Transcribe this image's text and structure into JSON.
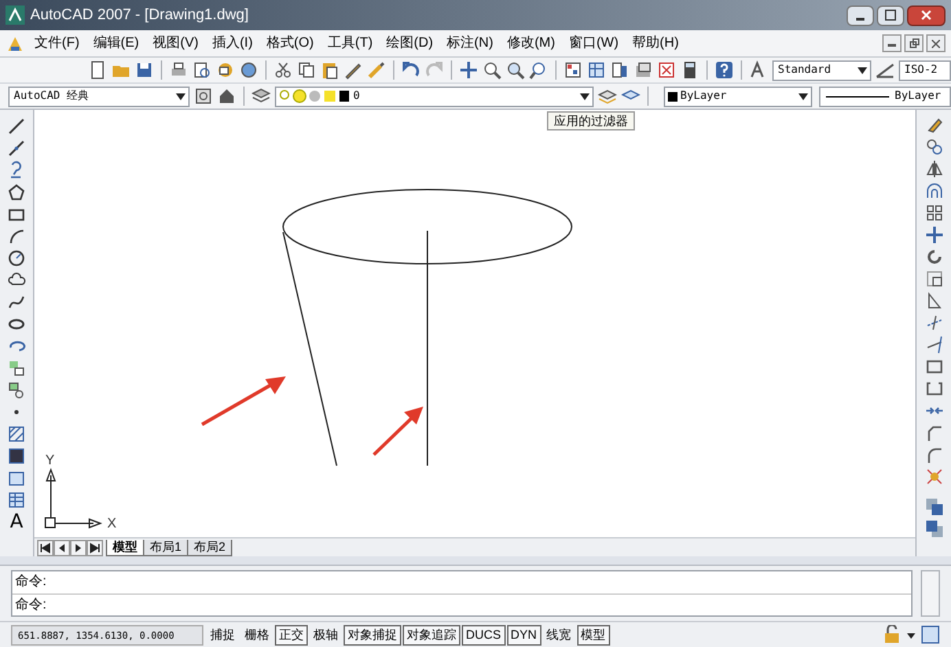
{
  "window": {
    "title": "AutoCAD 2007 - [Drawing1.dwg]"
  },
  "menu": [
    "文件(F)",
    "编辑(E)",
    "视图(V)",
    "插入(I)",
    "格式(O)",
    "工具(T)",
    "绘图(D)",
    "标注(N)",
    "修改(M)",
    "窗口(W)",
    "帮助(H)"
  ],
  "styles_toolbar": {
    "text_style": "Standard",
    "dim_style": "ISO-2"
  },
  "workspace": "AutoCAD 经典",
  "layer": "0",
  "color_control": "ByLayer",
  "text_tool_label": "A",
  "linetype": "ByLayer",
  "tooltip": "应用的过滤器",
  "ucs": {
    "x": "X",
    "y": "Y"
  },
  "layout_tabs": [
    {
      "label": "模型",
      "selected": true
    },
    {
      "label": "布局1",
      "selected": false
    },
    {
      "label": "布局2",
      "selected": false
    }
  ],
  "command_lines": [
    "命令:",
    "命令:"
  ],
  "status_bar": {
    "coordinates": "651.8887, 1354.6130, 0.0000",
    "toggles": [
      {
        "label": "捕捉",
        "on": false
      },
      {
        "label": "栅格",
        "on": false
      },
      {
        "label": "正交",
        "on": true
      },
      {
        "label": "极轴",
        "on": false
      },
      {
        "label": "对象捕捉",
        "on": true
      },
      {
        "label": "对象追踪",
        "on": true
      },
      {
        "label": "DUCS",
        "on": true
      },
      {
        "label": "DYN",
        "on": true
      },
      {
        "label": "线宽",
        "on": false
      },
      {
        "label": "模型",
        "on": true
      }
    ]
  }
}
